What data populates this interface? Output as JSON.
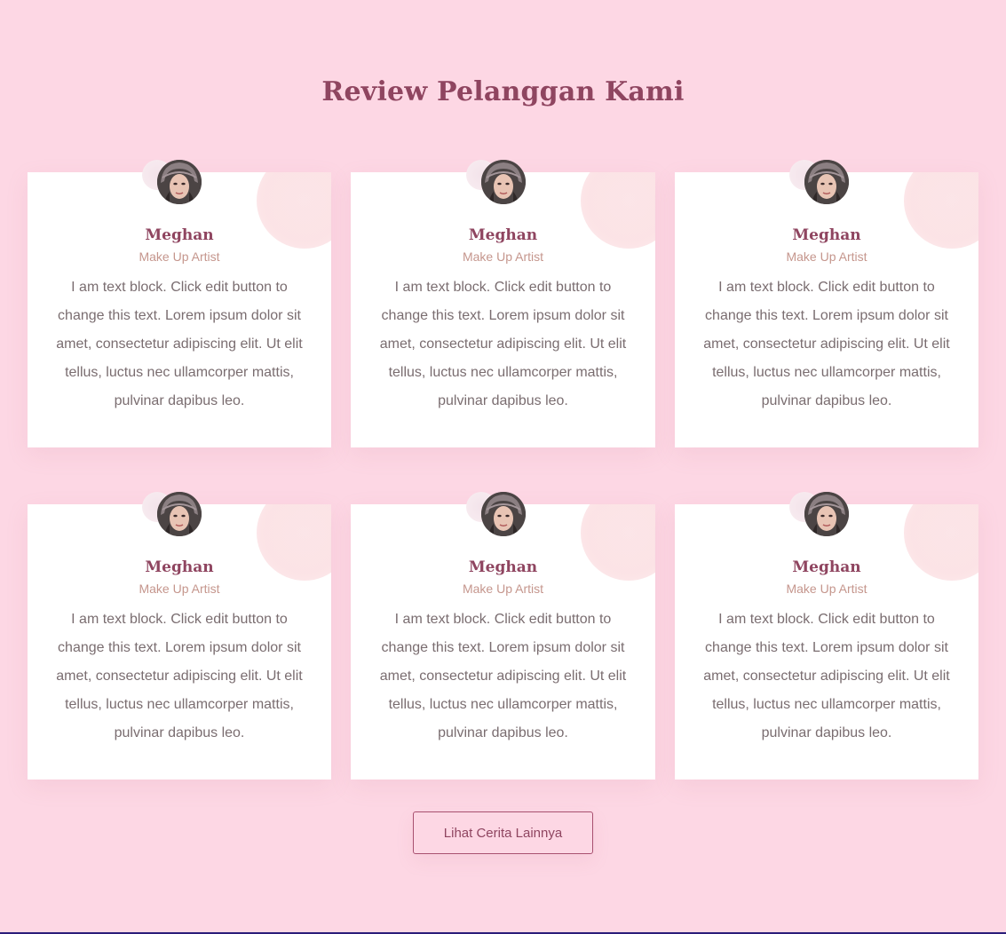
{
  "section": {
    "title": "Review Pelanggan Kami"
  },
  "testimonials": [
    {
      "name": "Meghan",
      "role": "Make Up Artist",
      "text": "I am text block. Click edit button to change this text. Lorem ipsum dolor sit amet, consectetur adipiscing elit. Ut elit tellus, luctus nec ullamcorper mattis, pulvinar dapibus leo."
    },
    {
      "name": "Meghan",
      "role": "Make Up Artist",
      "text": "I am text block. Click edit button to change this text. Lorem ipsum dolor sit amet, consectetur adipiscing elit. Ut elit tellus, luctus nec ullamcorper mattis, pulvinar dapibus leo."
    },
    {
      "name": "Meghan",
      "role": "Make Up Artist",
      "text": "I am text block. Click edit button to change this text. Lorem ipsum dolor sit amet, consectetur adipiscing elit. Ut elit tellus, luctus nec ullamcorper mattis, pulvinar dapibus leo."
    },
    {
      "name": "Meghan",
      "role": "Make Up Artist",
      "text": "I am text block. Click edit button to change this text. Lorem ipsum dolor sit amet, consectetur adipiscing elit. Ut elit tellus, luctus nec ullamcorper mattis, pulvinar dapibus leo."
    },
    {
      "name": "Meghan",
      "role": "Make Up Artist",
      "text": "I am text block. Click edit button to change this text. Lorem ipsum dolor sit amet, consectetur adipiscing elit. Ut elit tellus, luctus nec ullamcorper mattis, pulvinar dapibus leo."
    },
    {
      "name": "Meghan",
      "role": "Make Up Artist",
      "text": "I am text block. Click edit button to change this text. Lorem ipsum dolor sit amet, consectetur adipiscing elit. Ut elit tellus, luctus nec ullamcorper mattis, pulvinar dapibus leo."
    }
  ],
  "cta": {
    "label": "Lihat Cerita Lainnya"
  },
  "colors": {
    "background": "#fdd7e4",
    "accent": "#8f4560",
    "role_text": "#c5968d",
    "body_text": "#7a6d70"
  }
}
